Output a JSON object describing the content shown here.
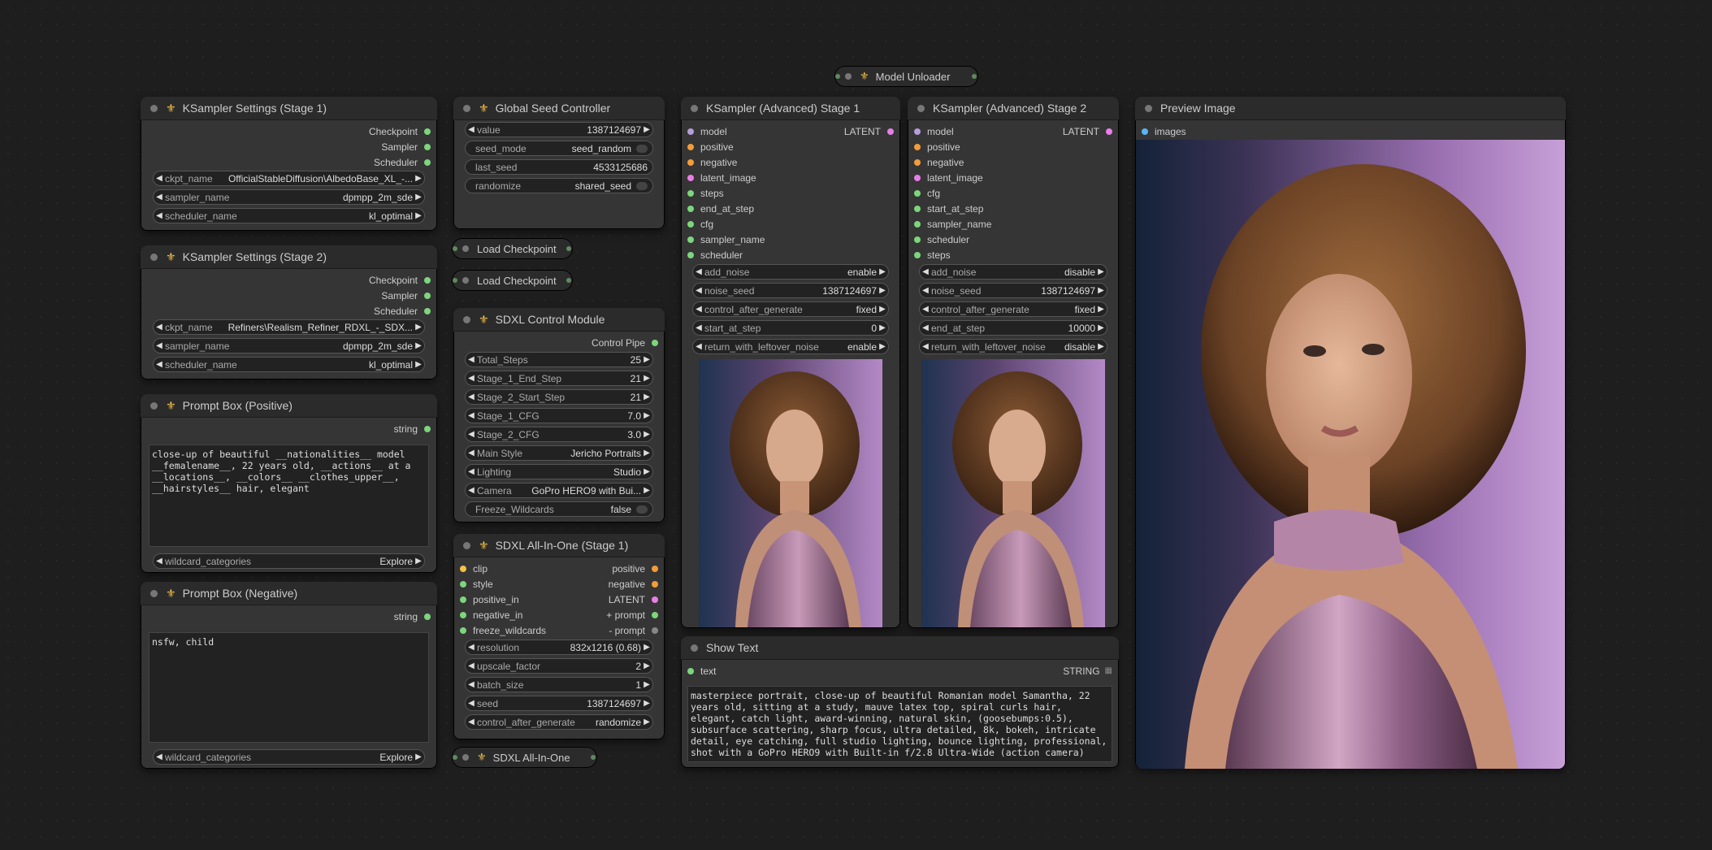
{
  "model_unloader": {
    "title": "Model Unloader"
  },
  "ks1": {
    "title": "KSampler Settings (Stage 1)",
    "outputs": [
      "Checkpoint",
      "Sampler",
      "Scheduler"
    ],
    "widgets": [
      {
        "label": "ckpt_name",
        "value": "OfficialStableDiffusion\\AlbedoBase_XL_-..."
      },
      {
        "label": "sampler_name",
        "value": "dpmpp_2m_sde"
      },
      {
        "label": "scheduler_name",
        "value": "kl_optimal"
      }
    ]
  },
  "ks2": {
    "title": "KSampler Settings (Stage 2)",
    "outputs": [
      "Checkpoint",
      "Sampler",
      "Scheduler"
    ],
    "widgets": [
      {
        "label": "ckpt_name",
        "value": "Refiners\\Realism_Refiner_RDXL_-_SDX..."
      },
      {
        "label": "sampler_name",
        "value": "dpmpp_2m_sde"
      },
      {
        "label": "scheduler_name",
        "value": "kl_optimal"
      }
    ]
  },
  "prompt_pos": {
    "title": "Prompt Box (Positive)",
    "output": "string",
    "text": "close-up of beautiful __nationalities__ model\n__femalename__, 22 years old, __actions__ at a\n__locations__, __colors__ __clothes_upper__,\n__hairstyles__ hair, elegant",
    "widget": {
      "label": "wildcard_categories",
      "value": "Explore"
    }
  },
  "prompt_neg": {
    "title": "Prompt Box (Negative)",
    "output": "string",
    "text": "nsfw, child",
    "widget": {
      "label": "wildcard_categories",
      "value": "Explore"
    }
  },
  "seed": {
    "title": "Global Seed Controller",
    "widgets": [
      {
        "label": "value",
        "value": "1387124697"
      },
      {
        "label": "seed_mode",
        "value": "seed_random"
      },
      {
        "label": "last_seed",
        "value": "4533125686"
      },
      {
        "label": "randomize",
        "value": "shared_seed"
      }
    ]
  },
  "load_ckpt_1": {
    "title": "Load Checkpoint"
  },
  "load_ckpt_2": {
    "title": "Load Checkpoint"
  },
  "control": {
    "title": "SDXL Control Module",
    "output": "Control Pipe",
    "widgets": [
      {
        "label": "Total_Steps",
        "value": "25"
      },
      {
        "label": "Stage_1_End_Step",
        "value": "21"
      },
      {
        "label": "Stage_2_Start_Step",
        "value": "21"
      },
      {
        "label": "Stage_1_CFG",
        "value": "7.0"
      },
      {
        "label": "Stage_2_CFG",
        "value": "3.0"
      },
      {
        "label": "Main Style",
        "value": "Jericho Portraits"
      },
      {
        "label": "Lighting",
        "value": "Studio"
      },
      {
        "label": "Camera",
        "value": "GoPro HERO9 with Bui..."
      },
      {
        "label": "Freeze_Wildcards",
        "value": "false"
      }
    ]
  },
  "aio1": {
    "title": "SDXL All-In-One (Stage 1)",
    "rows": [
      {
        "in": "clip",
        "out": "positive"
      },
      {
        "in": "style",
        "out": "negative"
      },
      {
        "in": "positive_in",
        "out": "LATENT"
      },
      {
        "in": "negative_in",
        "out": "+ prompt"
      },
      {
        "in": "freeze_wildcards",
        "out": "- prompt"
      }
    ],
    "widgets": [
      {
        "label": "resolution",
        "value": "832x1216 (0.68)"
      },
      {
        "label": "upscale_factor",
        "value": "2"
      },
      {
        "label": "batch_size",
        "value": "1"
      },
      {
        "label": "seed",
        "value": "1387124697"
      },
      {
        "label": "control_after_generate",
        "value": "randomize"
      }
    ]
  },
  "aio_collapsed": {
    "title": "SDXL All-In-One"
  },
  "kadv1": {
    "title": "KSampler (Advanced) Stage 1",
    "output": "LATENT",
    "inputs": [
      "model",
      "positive",
      "negative",
      "latent_image",
      "steps",
      "end_at_step",
      "cfg",
      "sampler_name",
      "scheduler"
    ],
    "widgets": [
      {
        "label": "add_noise",
        "value": "enable"
      },
      {
        "label": "noise_seed",
        "value": "1387124697"
      },
      {
        "label": "control_after_generate",
        "value": "fixed"
      },
      {
        "label": "start_at_step",
        "value": "0"
      },
      {
        "label": "return_with_leftover_noise",
        "value": "enable"
      }
    ]
  },
  "kadv2": {
    "title": "KSampler (Advanced) Stage 2",
    "output": "LATENT",
    "inputs": [
      "model",
      "positive",
      "negative",
      "latent_image",
      "cfg",
      "start_at_step",
      "sampler_name",
      "scheduler",
      "steps"
    ],
    "widgets": [
      {
        "label": "add_noise",
        "value": "disable"
      },
      {
        "label": "noise_seed",
        "value": "1387124697"
      },
      {
        "label": "control_after_generate",
        "value": "fixed"
      },
      {
        "label": "end_at_step",
        "value": "10000"
      },
      {
        "label": "return_with_leftover_noise",
        "value": "disable"
      }
    ]
  },
  "show_text": {
    "title": "Show Text",
    "input": "text",
    "output": "STRING",
    "text": "masterpiece portrait, close-up of beautiful Romanian model Samantha, 22\nyears old, sitting at a study, mauve latex top, spiral curls hair,\nelegant, catch light, award-winning, natural skin, (goosebumps:0.5),\nsubsurface scattering, sharp focus, ultra detailed, 8k, bokeh, intricate\ndetail, eye catching, full studio lighting, bounce lighting, professional,\nshot with a GoPro HERO9 with Built-in f/2.8 Ultra-Wide (action camera)"
  },
  "preview": {
    "title": "Preview Image",
    "input": "images"
  },
  "colors": {
    "accent": "#f5c146",
    "canvas": "#1e1e1e",
    "node": "#353535"
  }
}
